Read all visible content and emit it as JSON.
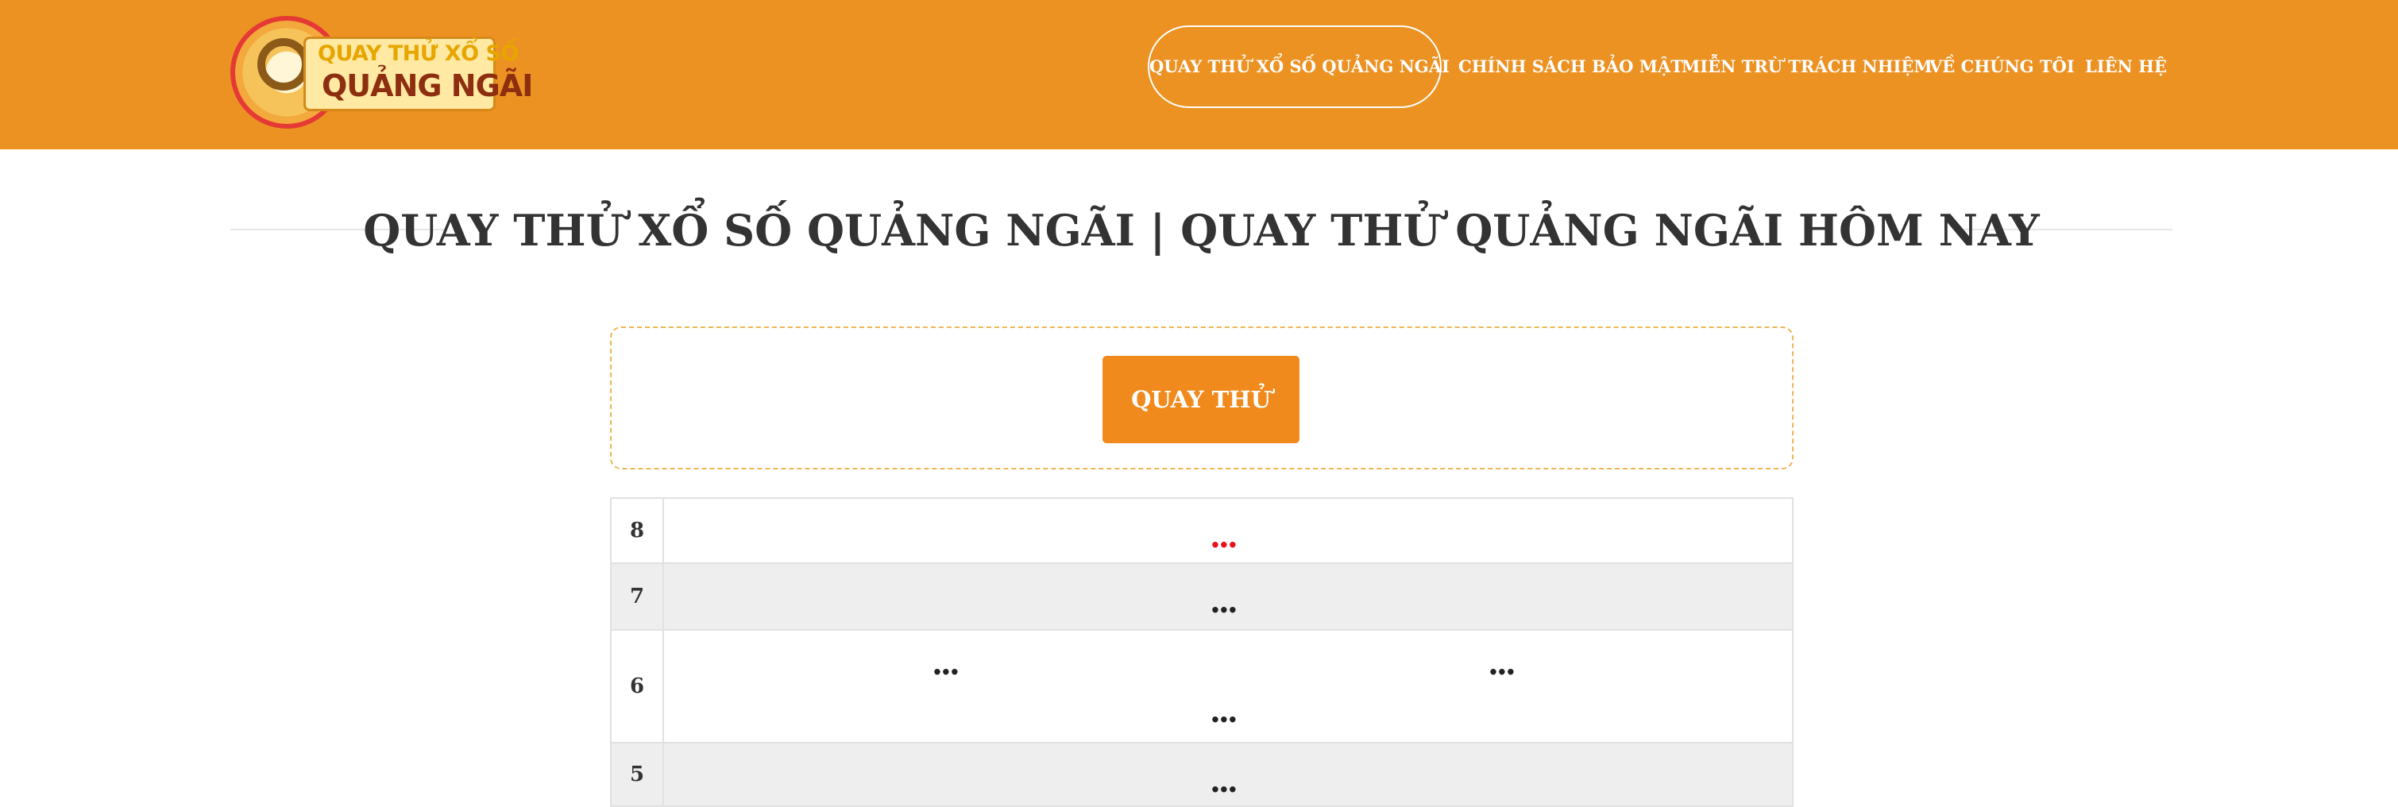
{
  "logo": {
    "line1": "QUAY THỬ XỔ SỐ",
    "line2": "QUẢNG NGÃI"
  },
  "nav": {
    "items": [
      {
        "label": "QUAY THỬ XỔ SỐ QUẢNG NGÃI",
        "active": true
      },
      {
        "label": "CHÍNH SÁCH BẢO MẬT"
      },
      {
        "label": "MIỄN TRỪ TRÁCH NHIỆM"
      },
      {
        "label": "VỀ CHÚNG TÔI"
      },
      {
        "label": "LIÊN HỆ"
      }
    ]
  },
  "page": {
    "title": "QUAY THỬ XỔ SỐ QUẢNG NGÃI | QUAY THỬ QUẢNG NGÃI HÔM NAY"
  },
  "spin": {
    "button_label": "QUAY THỬ"
  },
  "results": {
    "rows": [
      {
        "prize": "8",
        "values": [
          "..."
        ]
      },
      {
        "prize": "7",
        "values": [
          "..."
        ]
      },
      {
        "prize": "6",
        "values": [
          "...",
          "...",
          "..."
        ]
      },
      {
        "prize": "5",
        "values": [
          "..."
        ]
      }
    ]
  },
  "colors": {
    "header_bg": "#ec9223",
    "button_bg": "#f08a1d",
    "prize8_value": "#e8121b"
  }
}
